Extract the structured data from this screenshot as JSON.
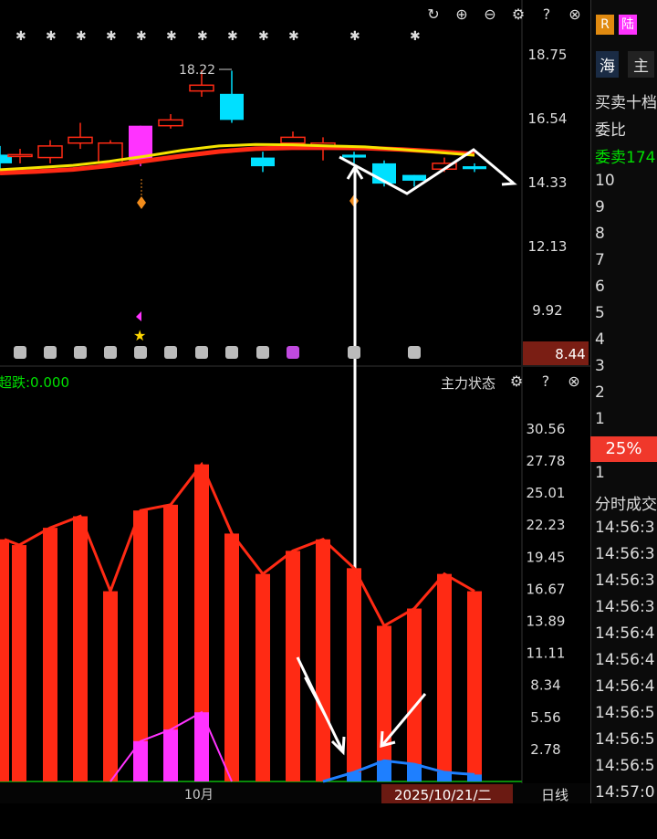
{
  "top_chart": {
    "price_ticks": [
      "18.75",
      "16.54",
      "14.33",
      "12.13",
      "9.92"
    ],
    "current_price_badge": "8.44",
    "high_annotation": "18.22",
    "candles": [
      {
        "o": 15.3,
        "c": 15.0,
        "h": 15.6,
        "l": 14.8
      },
      {
        "o": 15.3,
        "c": 15.3,
        "h": 15.5,
        "l": 15.0
      },
      {
        "o": 15.2,
        "c": 15.6,
        "h": 15.8,
        "l": 15.0
      },
      {
        "o": 15.7,
        "c": 15.9,
        "h": 16.4,
        "l": 15.5
      },
      {
        "o": 15.0,
        "c": 15.7,
        "h": 15.8,
        "l": 14.9
      },
      {
        "o": 15.1,
        "c": 16.3,
        "h": 16.3,
        "l": 14.9
      },
      {
        "o": 16.3,
        "c": 16.5,
        "h": 16.7,
        "l": 16.2
      },
      {
        "o": 17.5,
        "c": 17.7,
        "h": 18.22,
        "l": 17.3
      },
      {
        "o": 17.4,
        "c": 16.5,
        "h": 18.2,
        "l": 16.4
      },
      {
        "o": 15.2,
        "c": 14.9,
        "h": 15.4,
        "l": 14.7
      },
      {
        "o": 15.7,
        "c": 15.9,
        "h": 16.1,
        "l": 15.6
      },
      {
        "o": 15.6,
        "c": 15.7,
        "h": 15.9,
        "l": 15.1
      },
      {
        "o": 15.3,
        "c": 15.2,
        "h": 15.4,
        "l": 15.0
      },
      {
        "o": 15.0,
        "c": 14.3,
        "h": 15.1,
        "l": 14.2
      },
      {
        "o": 14.6,
        "c": 14.4,
        "h": 14.6,
        "l": 14.2
      },
      {
        "o": 14.8,
        "c": 15.0,
        "h": 15.2,
        "l": 14.7
      },
      {
        "o": 14.9,
        "c": 14.8,
        "h": 15.0,
        "l": 14.7
      }
    ],
    "ma_yellow": [
      14.78,
      14.85,
      14.93,
      15.07,
      15.25,
      15.45,
      15.6,
      15.65,
      15.64,
      15.6,
      15.57,
      15.48,
      15.38,
      15.28
    ],
    "ma_red": [
      14.73,
      14.78,
      14.85,
      14.98,
      15.15,
      15.32,
      15.47,
      15.57,
      15.6,
      15.6,
      15.59,
      15.54,
      15.47,
      15.38
    ]
  },
  "lower_chart": {
    "title": "主力状态",
    "indicator_label": "超跌:0.000",
    "ticks": [
      "30.56",
      "27.78",
      "25.01",
      "22.23",
      "19.45",
      "16.67",
      "13.89",
      "11.11",
      "8.34",
      "5.56",
      "2.78"
    ],
    "red_bars": [
      21,
      20.5,
      22,
      23,
      16.5,
      23.5,
      24,
      27.5,
      21.5,
      18,
      20,
      21,
      18.5,
      13.5,
      15,
      18,
      16.5
    ],
    "magenta_bars": [
      0,
      0,
      0,
      0,
      0,
      3.5,
      4.5,
      6,
      0,
      0,
      0,
      0,
      0,
      0,
      0,
      0,
      0
    ],
    "blue_bars": [
      0,
      0,
      0,
      0,
      0,
      0,
      0,
      0,
      0,
      0,
      0,
      0,
      0.8,
      1.8,
      1.5,
      0.8,
      0.6
    ],
    "month_label": "10月",
    "date_label": "2025/10/21/二",
    "period_label": "日线"
  },
  "right_panel": {
    "badge_r": "R",
    "badge_lu": "陆",
    "btn_hai": "海",
    "btn_zhu": "主",
    "order_book_title": "买卖十档",
    "wei_bi": "委比",
    "wei_mai": "委卖174",
    "levels": [
      "10",
      "9",
      "8",
      "7",
      "6",
      "5",
      "4",
      "3",
      "2",
      "1"
    ],
    "pct": "25%",
    "bid_level": "1",
    "time_sales_title": "分时成交",
    "times": [
      "14:56:3",
      "14:56:3",
      "14:56:3",
      "14:56:3",
      "14:56:4",
      "14:56:4",
      "14:56:4",
      "14:56:5",
      "14:56:5",
      "14:56:5",
      "14:57:0"
    ]
  },
  "colors": {
    "up": "#ff2a14",
    "down": "#00e0ff",
    "yellow": "#f5e400",
    "red_line": "#ff2a14",
    "magenta": "#ff33ff",
    "blue": "#1e7fff",
    "green_text": "#00e000"
  }
}
